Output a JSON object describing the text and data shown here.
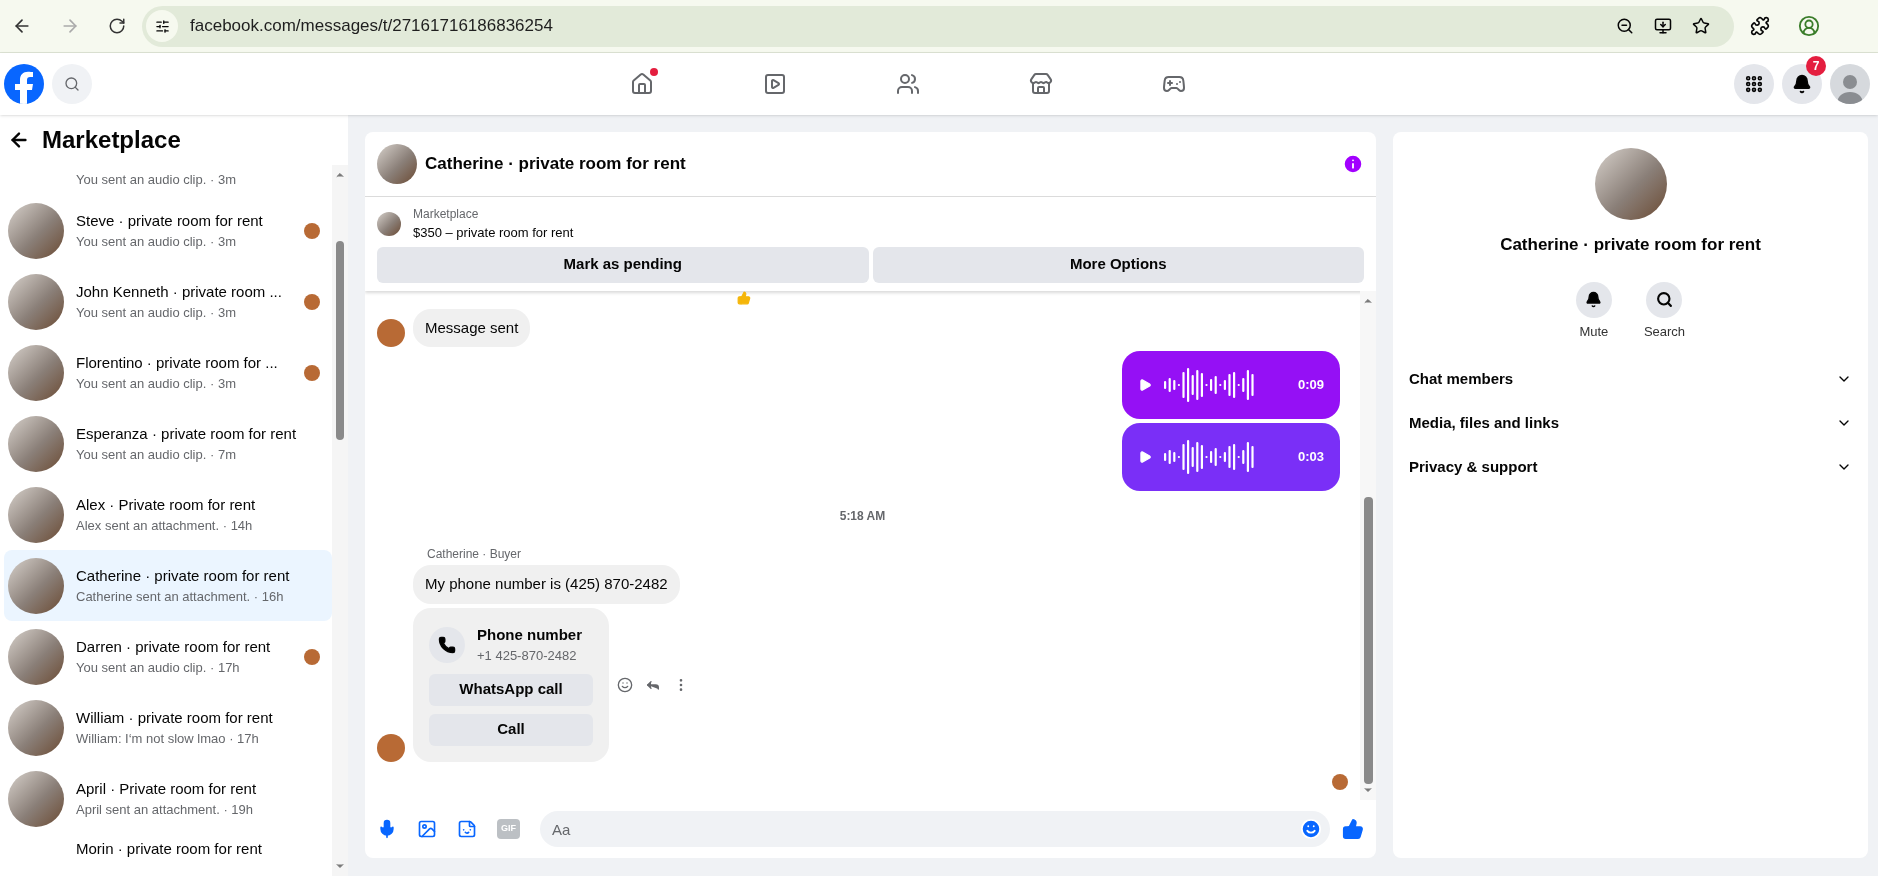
{
  "browser": {
    "url": "facebook.com/messages/t/27161716186836254",
    "forward_disabled": true
  },
  "nav": {
    "tabs": [
      {
        "kind": "home",
        "selected": false,
        "notification_dot": true
      },
      {
        "kind": "video",
        "selected": false,
        "notification_dot": false
      },
      {
        "kind": "friends",
        "selected": false,
        "notification_dot": false
      },
      {
        "kind": "marketplace",
        "selected": false,
        "notification_dot": false
      },
      {
        "kind": "gaming",
        "selected": false,
        "notification_dot": false
      }
    ],
    "notification_count": "7"
  },
  "sidebar": {
    "title": "Marketplace",
    "conversations": [
      {
        "subtitle": "You sent an audio clip. · 3m",
        "selected": false,
        "seen": false
      },
      {
        "title": "Steve · private room for rent",
        "subtitle": "You sent an audio clip. · 3m",
        "selected": false,
        "seen": true
      },
      {
        "title": "John Kenneth · private room ...",
        "subtitle": "You sent an audio clip. · 3m",
        "selected": false,
        "seen": true
      },
      {
        "title": "Florentino · private room for ...",
        "subtitle": "You sent an audio clip. · 3m",
        "selected": false,
        "seen": true
      },
      {
        "title": "Esperanza · private room for rent",
        "subtitle": "You sent an audio clip. · 7m",
        "selected": false,
        "seen": false
      },
      {
        "title": "Alex · Private room for rent",
        "subtitle": "Alex sent an attachment. · 14h",
        "selected": false,
        "seen": false
      },
      {
        "title": "Catherine · private room for rent",
        "subtitle": "Catherine sent an attachment. · 16h",
        "selected": true,
        "seen": false
      },
      {
        "title": "Darren · private room for rent",
        "subtitle": "You sent an audio clip. · 17h",
        "selected": false,
        "seen": true
      },
      {
        "title": "William · private room for rent",
        "subtitle": "William: I‘m not slow lmao · 17h",
        "selected": false,
        "seen": false
      },
      {
        "title": "April · Private room for rent",
        "subtitle": "April sent an attachment. · 19h",
        "selected": false,
        "seen": false
      },
      {
        "title": "Morin · private room for rent",
        "selected": false,
        "seen": false
      }
    ]
  },
  "chat": {
    "title": "Catherine · private room for rent",
    "listing": {
      "label": "Marketplace",
      "title": "$350 – private room for rent",
      "buttons": [
        "Mark as pending",
        "More Options"
      ]
    },
    "messages": [
      {
        "kind": "reaction"
      },
      {
        "kind": "text",
        "text": "Message sent",
        "avatar": true
      },
      {
        "kind": "audio",
        "duration": "0:09"
      },
      {
        "kind": "audio",
        "duration": "0:03"
      },
      {
        "kind": "timestamp",
        "text": "5:18 AM"
      },
      {
        "kind": "sender",
        "text": "Catherine · Buyer"
      },
      {
        "kind": "text",
        "text": "My phone number is (425) 870-2482",
        "avatar": false
      },
      {
        "kind": "contact",
        "title": "Phone number",
        "number": "+1 425-870-2482",
        "buttons": [
          "WhatsApp call",
          "Call"
        ],
        "avatar": true
      }
    ],
    "composer": {
      "placeholder": "Aa",
      "gif": "GIF"
    }
  },
  "details": {
    "title": "Catherine · private room for rent",
    "actions": [
      {
        "kind": "mute",
        "label": "Mute"
      },
      {
        "kind": "search",
        "label": "Search"
      }
    ],
    "sections": [
      {
        "label": "Chat members",
        "expanded": false
      },
      {
        "label": "Media, files and links",
        "expanded": false
      },
      {
        "label": "Privacy & support",
        "expanded": false
      }
    ]
  }
}
